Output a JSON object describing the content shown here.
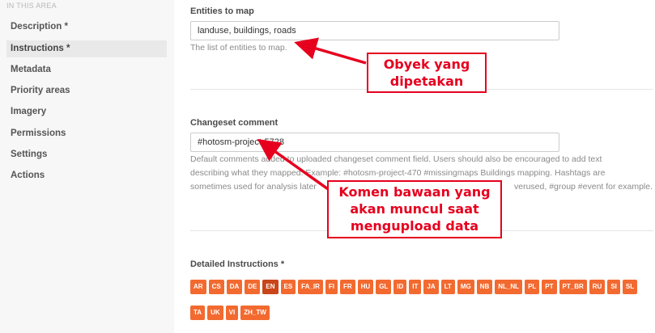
{
  "sidebar": {
    "section_label": "IN THIS AREA",
    "items": [
      {
        "label": "Description *"
      },
      {
        "label": "Instructions *"
      },
      {
        "label": "Metadata"
      },
      {
        "label": "Priority areas"
      },
      {
        "label": "Imagery"
      },
      {
        "label": "Permissions"
      },
      {
        "label": "Settings"
      },
      {
        "label": "Actions"
      }
    ],
    "active_item": "Instructions *"
  },
  "entities": {
    "label": "Entities to map",
    "value": "landuse, buildings, roads",
    "help": "The list of entities to map."
  },
  "changeset": {
    "label": "Changeset comment",
    "value": "#hotosm-project-5728",
    "help_line1": "Default comments added to uploaded changeset comment field. Users should also be encouraged to add text",
    "help_line2": "describing what they mapped. Example: #hotosm-project-470 #missingmaps Buildings mapping. Hashtags are",
    "help_line3_start": "sometimes used for analysis later",
    "help_line3_end": "verused, #group #event for example."
  },
  "instructions": {
    "label": "Detailed Instructions *",
    "languages_row1": [
      "AR",
      "CS",
      "DA",
      "DE",
      "EN",
      "ES",
      "FA_IR",
      "FI",
      "FR",
      "HU",
      "GL",
      "ID",
      "IT",
      "JA",
      "LT",
      "MG",
      "NB",
      "NL_NL",
      "PL",
      "PT",
      "PT_BR",
      "RU",
      "SI",
      "SL"
    ],
    "languages_row2": [
      "TA",
      "UK",
      "VI",
      "ZH_TW"
    ],
    "selected_language": "EN"
  },
  "annotations": {
    "callout1_line1": "Obyek yang",
    "callout1_line2": "dipetakan",
    "callout2_line1": "Komen bawaan yang",
    "callout2_line2": "akan muncul saat",
    "callout2_line3": "mengupload data",
    "color": "#e6001e"
  },
  "colors": {
    "accent": "#f26a30",
    "accent_selected": "#c9451a",
    "sidebar_bg": "#f7f7f7"
  }
}
